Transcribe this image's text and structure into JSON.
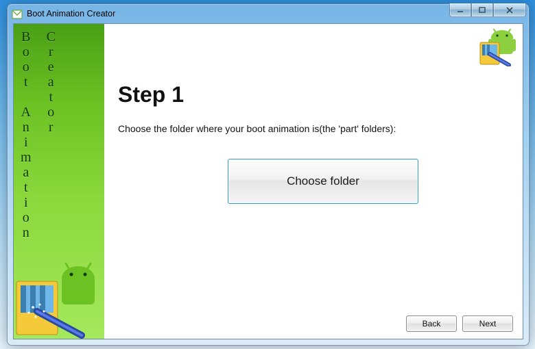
{
  "window": {
    "title": "Boot Animation Creator"
  },
  "sidebar": {
    "col1": [
      "B",
      "o",
      "o",
      "t",
      "",
      "A",
      "n",
      "i",
      "m",
      "a",
      "t",
      "i",
      "o",
      "n"
    ],
    "col2": [
      "C",
      "r",
      "e",
      "a",
      "t",
      "o",
      "r"
    ]
  },
  "step": {
    "title": "Step 1",
    "instruction": "Choose the folder where your boot animation is(the 'part' folders):",
    "choose_folder_label": "Choose folder"
  },
  "nav": {
    "back": "Back",
    "next": "Next"
  }
}
